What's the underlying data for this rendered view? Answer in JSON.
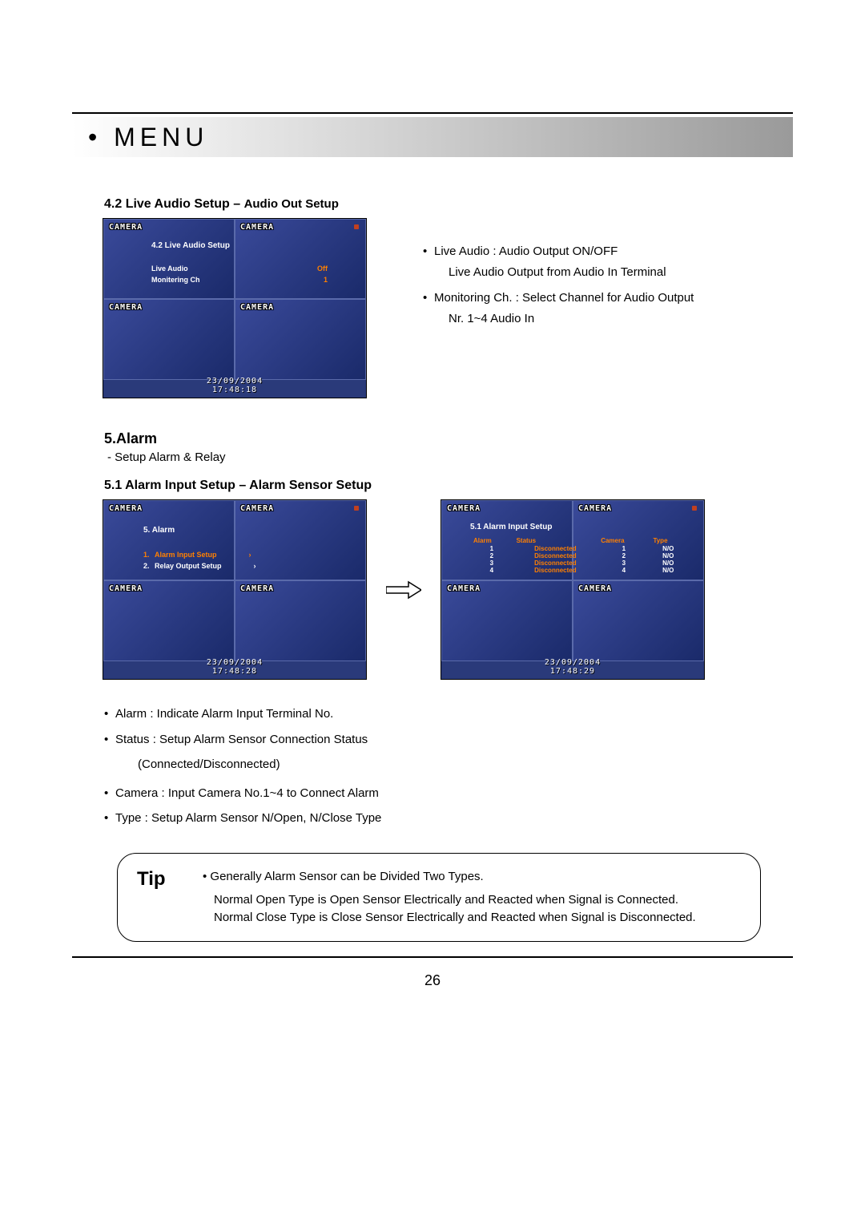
{
  "header": {
    "title": "• MENU"
  },
  "sec42": {
    "heading_main": "4.2 Live Audio Setup – ",
    "heading_sub": "Audio Out Setup",
    "screenshot": {
      "cam_label": "CAMERA",
      "menu_title": "4.2 Live Audio Setup",
      "rows": [
        {
          "label": "Live Audio",
          "value": "Off"
        },
        {
          "label": "Monitering Ch",
          "value": "1"
        }
      ],
      "timestamp_line1": "23/09/2004",
      "timestamp_line2": "17:48:18"
    },
    "notes": {
      "b1": "Live Audio : Audio Output ON/OFF",
      "b1b": "Live Audio Output from Audio In Terminal",
      "b2": "Monitoring Ch. : Select Channel for Audio Output",
      "b2b": "Nr. 1~4 Audio In"
    }
  },
  "sec5": {
    "heading": "5.Alarm",
    "sub": "- Setup Alarm & Relay"
  },
  "sec51": {
    "heading": "5.1 Alarm Input Setup – Alarm Sensor Setup",
    "left_shot": {
      "cam_label": "CAMERA",
      "menu_title": "5. Alarm",
      "items": [
        {
          "num": "1.",
          "text": "Alarm Input Setup"
        },
        {
          "num": "2.",
          "text": "Relay Output Setup"
        }
      ],
      "timestamp_line1": "23/09/2004",
      "timestamp_line2": "17:48:28"
    },
    "right_shot": {
      "cam_label": "CAMERA",
      "menu_title": "5.1 Alarm Input Setup",
      "headers": [
        "Alarm",
        "Status",
        "Camera",
        "Type"
      ],
      "rows": [
        {
          "alarm": "1",
          "status": "Disconnected",
          "camera": "1",
          "type": "N/O"
        },
        {
          "alarm": "2",
          "status": "Disconnected",
          "camera": "2",
          "type": "N/O"
        },
        {
          "alarm": "3",
          "status": "Disconnected",
          "camera": "3",
          "type": "N/O"
        },
        {
          "alarm": "4",
          "status": "Disconnected",
          "camera": "4",
          "type": "N/O"
        }
      ],
      "timestamp_line1": "23/09/2004",
      "timestamp_line2": "17:48:29"
    },
    "desc": {
      "d1": "Alarm : Indicate Alarm Input Terminal No.",
      "d2": "Status : Setup Alarm Sensor Connection Status",
      "d2b": "(Connected/Disconnected)",
      "d3": "Camera : Input Camera No.1~4 to Connect Alarm",
      "d4": "Type : Setup Alarm Sensor N/Open, N/Close Type"
    }
  },
  "tip": {
    "label": "Tip",
    "line1": "Generally Alarm Sensor can be Divided Two Types.",
    "line2": "Normal Open Type is Open Sensor Electrically and Reacted when Signal is Connected.",
    "line3": "Normal Close Type is Close Sensor Electrically and Reacted when Signal is Disconnected."
  },
  "page_number": "26"
}
